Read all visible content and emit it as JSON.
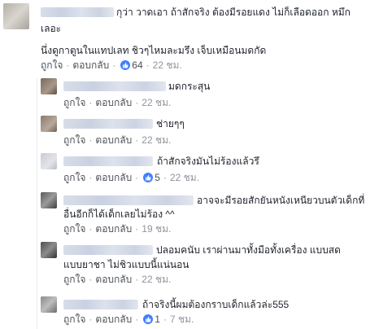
{
  "comments": [
    {
      "lines": [
        "กุว่า วาดเอา ถ้าสักจริง ต้องมีรอยแดง ไม่ก็เลือดออก หมึก",
        "เลอะ",
        "",
        "นึ่งดูกาตูนในแทปเลท ชิวๆไหมละมรึง เจ็บเหมือนมดกัด"
      ],
      "like_label": "ถูกใจ",
      "reply_label": "ตอบกลับ",
      "reaction_count": "64",
      "time": "22 ชม."
    },
    {
      "lines": [
        "มดกระสุน"
      ],
      "like_label": "ถูกใจ",
      "reply_label": "ตอบกลับ",
      "reaction_count": "",
      "time": "22 ชม."
    },
    {
      "lines": [
        "ช่ายๆๆ"
      ],
      "like_label": "ถูกใจ",
      "reply_label": "ตอบกลับ",
      "reaction_count": "",
      "time": "22 ชม."
    },
    {
      "lines": [
        "ถ้าสักจริงมันไม่ร้องแล้วรึ"
      ],
      "like_label": "ถูกใจ",
      "reply_label": "ตอบกลับ",
      "reaction_count": "5",
      "time": "22 ชม."
    },
    {
      "lines": [
        "อาจจะมีรอยสักยันหนังเหนียวบนตัวเด็กที่",
        "อื่นอีกก็ได้เด็กเลยไม่ร้อง ^^"
      ],
      "like_label": "ถูกใจ",
      "reply_label": "ตอบกลับ",
      "reaction_count": "",
      "time": "19 ชม."
    },
    {
      "lines": [
        "ปลอมคนับ เราผ่านมาทั้งมือทั้งเครื่อง แบบสด",
        "แบบยาชา ไม่ชิวแบบนี้แน่นอน"
      ],
      "like_label": "ถูกใจ",
      "reply_label": "ตอบกลับ",
      "reaction_count": "",
      "time": "22 ชม."
    },
    {
      "lines": [
        "ถ้าจริงนี้ผมต้องกราบเด็กแล้วล่ะ555"
      ],
      "like_label": "ถูกใจ",
      "reply_label": "ตอบกลับ",
      "reaction_count": "1",
      "time": "7 ชม."
    }
  ],
  "colors": {
    "link": "#4b4f56",
    "meta": "#90949c",
    "like_blue": "#4080ff"
  },
  "icons": {
    "reaction": "like-thumb-icon"
  }
}
